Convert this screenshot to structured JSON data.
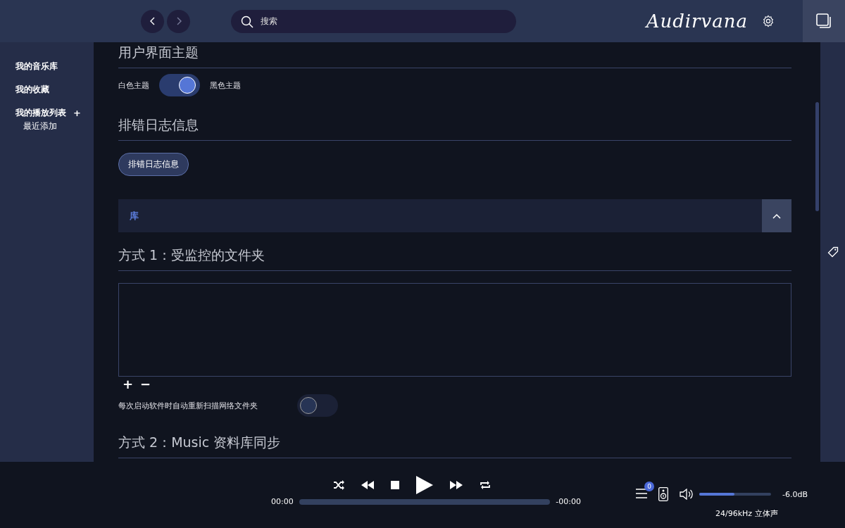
{
  "toolbar": {
    "search": {
      "placeholder": "搜索"
    },
    "logo": "Audirvana"
  },
  "sidebar": {
    "items": [
      {
        "label": "我的音乐库",
        "selected": false
      },
      {
        "label": "我的收藏",
        "selected": false
      },
      {
        "label": "我的播放列表",
        "selected": false
      }
    ],
    "add_label": "+",
    "playlists": [
      "最近添加"
    ]
  },
  "settings": {
    "theme": {
      "heading": "用户界面主题",
      "left_label": "白色主题",
      "right_label": "黑色主题",
      "on": true
    },
    "log": {
      "heading": "排错日志信息",
      "button": "排错日志信息"
    },
    "library": {
      "title": "库",
      "expanded": true,
      "method1": {
        "heading": "方式 1：受监控的文件夹",
        "add": "+",
        "remove": "−",
        "rescan_label": "每次启动软件时自动重新扫描网络文件夹",
        "rescan_on": false
      },
      "method2": {
        "heading": "方式 2：Music 资料库同步"
      }
    }
  },
  "player": {
    "elapsed": "00:00",
    "remaining": "-00:00",
    "level": 0,
    "queue_count": "0",
    "volume": {
      "level": 0.49,
      "reading": "-6.0dB"
    },
    "format": "24/96kHz 立体声"
  }
}
